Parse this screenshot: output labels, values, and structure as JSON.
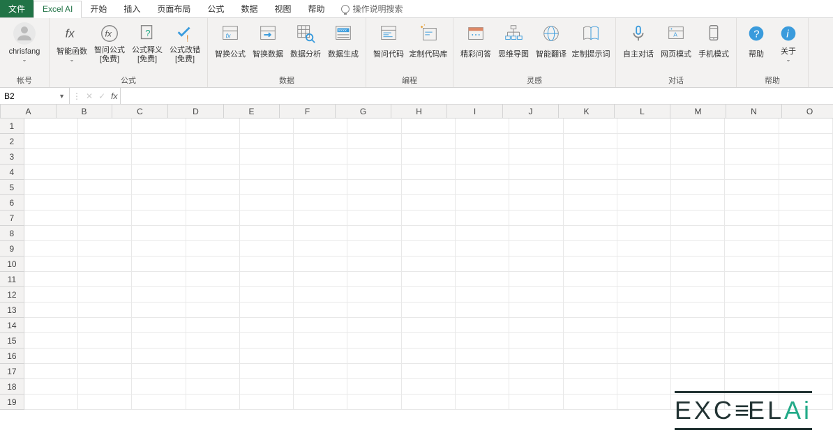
{
  "tabs": {
    "file": "文件",
    "active": "Excel AI",
    "others": [
      "开始",
      "插入",
      "页面布局",
      "公式",
      "数据",
      "视图",
      "帮助"
    ],
    "tellme": "操作说明搜索"
  },
  "ribbon": {
    "groups": [
      {
        "label": "帐号",
        "items": [
          {
            "id": "account",
            "label": "chrisfang",
            "sub": ""
          }
        ]
      },
      {
        "label": "公式",
        "items": [
          {
            "id": "smart-fn",
            "label": "智能函数",
            "sub": ""
          },
          {
            "id": "ask-formula",
            "label": "智问公式",
            "sub": "[免费]"
          },
          {
            "id": "formula-explain",
            "label": "公式释义",
            "sub": "[免费]"
          },
          {
            "id": "formula-fix",
            "label": "公式改错",
            "sub": "[免费]"
          }
        ]
      },
      {
        "label": "数据",
        "items": [
          {
            "id": "swap-formula",
            "label": "智换公式",
            "sub": ""
          },
          {
            "id": "swap-data",
            "label": "智换数据",
            "sub": ""
          },
          {
            "id": "data-analyze",
            "label": "数据分析",
            "sub": ""
          },
          {
            "id": "data-gen",
            "label": "数据生成",
            "sub": ""
          }
        ]
      },
      {
        "label": "编程",
        "items": [
          {
            "id": "smart-code",
            "label": "智问代码",
            "sub": ""
          },
          {
            "id": "code-lib",
            "label": "定制代码库",
            "sub": ""
          }
        ]
      },
      {
        "label": "灵感",
        "items": [
          {
            "id": "qa",
            "label": "精彩问答",
            "sub": ""
          },
          {
            "id": "mindmap",
            "label": "思维导图",
            "sub": ""
          },
          {
            "id": "translate",
            "label": "智能翻译",
            "sub": ""
          },
          {
            "id": "prompts",
            "label": "定制提示词",
            "sub": ""
          }
        ]
      },
      {
        "label": "对话",
        "items": [
          {
            "id": "auto-chat",
            "label": "自主对话",
            "sub": ""
          },
          {
            "id": "web-mode",
            "label": "网页模式",
            "sub": ""
          },
          {
            "id": "mobile-mode",
            "label": "手机模式",
            "sub": ""
          }
        ]
      },
      {
        "label": "帮助",
        "items": [
          {
            "id": "help",
            "label": "帮助",
            "sub": ""
          },
          {
            "id": "about",
            "label": "关于",
            "sub": ""
          }
        ]
      }
    ]
  },
  "formulaBar": {
    "cellRef": "B2",
    "value": ""
  },
  "grid": {
    "columns": [
      "A",
      "B",
      "C",
      "D",
      "E",
      "F",
      "G",
      "H",
      "I",
      "J",
      "K",
      "L",
      "M",
      "N",
      "O"
    ],
    "rows": 19
  },
  "watermark": {
    "text1": "EXC",
    "text2": "EL",
    "text3": "Ai"
  }
}
